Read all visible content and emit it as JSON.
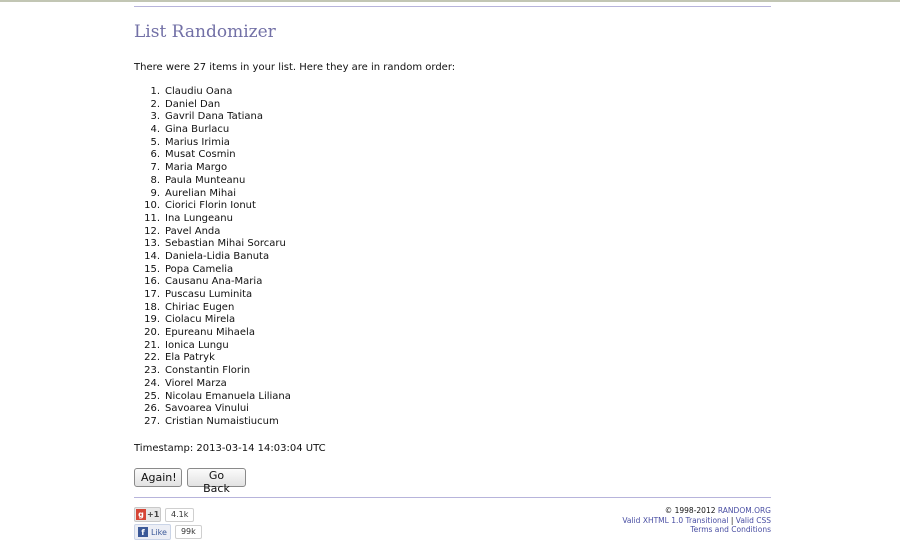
{
  "page": {
    "title": "List Randomizer",
    "intro": "There were 27 items in your list. Here they are in random order:",
    "items": [
      "Claudiu Oana",
      "Daniel Dan",
      "Gavril Dana Tatiana",
      "Gina Burlacu",
      "Marius Irimia",
      "Musat Cosmin",
      "Maria Margo",
      "Paula Munteanu",
      "Aurelian Mihai",
      "Ciorici Florin Ionut",
      "Ina Lungeanu",
      "Pavel Anda",
      "Sebastian Mihai Sorcaru",
      "Daniela-Lidia Banuta",
      "Popa Camelia",
      "Causanu Ana-Maria",
      "Puscasu Luminita",
      "Chiriac Eugen",
      "Ciolacu Mirela",
      "Epureanu Mihaela",
      "Ionica Lungu",
      "Ela Patryk",
      "Constantin Florin",
      "Viorel Marza",
      "Nicolau Emanuela Liliana",
      "Savoarea Vinului",
      "Cristian Numaistiucum"
    ],
    "timestamp": "Timestamp: 2013-03-14 14:03:04 UTC"
  },
  "buttons": {
    "again": "Again!",
    "go_back": "Go Back"
  },
  "social": {
    "gplus_label": "+1",
    "gplus_count": "4.1k",
    "fb_label": "Like",
    "fb_count": "99k"
  },
  "footer": {
    "copyright": "© 1998-2012 ",
    "site_link": "RANDOM.ORG",
    "xhtml_link": "Valid XHTML 1.0 Transitional",
    "separator": " | ",
    "css_link": "Valid CSS",
    "terms_link": "Terms and Conditions"
  },
  "colors": {
    "heading": "#7270a6",
    "rule": "#b7b4db",
    "link": "#4a4fa3"
  }
}
